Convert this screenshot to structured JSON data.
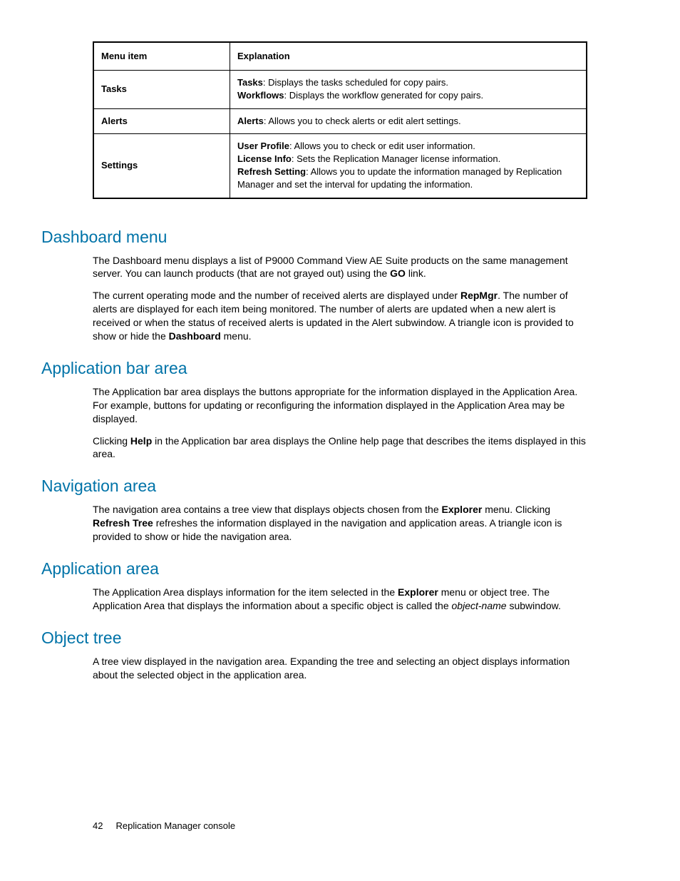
{
  "table": {
    "head": {
      "menu": "Menu item",
      "expl": "Explanation"
    },
    "rows": [
      {
        "menu": "Tasks",
        "lines": [
          {
            "b": "Tasks",
            "t": ": Displays the tasks scheduled for copy pairs."
          },
          {
            "b": "Workflows",
            "t": ": Displays the workflow generated for copy pairs."
          }
        ]
      },
      {
        "menu": "Alerts",
        "lines": [
          {
            "b": "Alerts",
            "t": ": Allows you to check alerts or edit alert settings."
          }
        ]
      },
      {
        "menu": "Settings",
        "lines": [
          {
            "b": "User Profile",
            "t": ": Allows you to check or edit user information."
          },
          {
            "b": "License Info",
            "t": ": Sets the Replication Manager license information."
          },
          {
            "b": "Refresh Setting",
            "t": ": Allows you to update the information managed by Replication Manager and set the interval for updating the information."
          }
        ]
      }
    ]
  },
  "sections": {
    "dashboard": {
      "title": "Dashboard menu",
      "p1a": "The Dashboard menu displays a list of P9000 Command View AE Suite products on the same management server.  You can launch products (that are not grayed out) using the ",
      "p1b": "GO",
      "p1c": " link.",
      "p2a": "The current operating mode and the number of received alerts are displayed under ",
      "p2b": "RepMgr",
      "p2c": ". The number of alerts are displayed for each item being monitored. The number of alerts are updated when a new alert is received or when the status of received alerts is updated in the Alert subwindow. A triangle icon is provided to show or hide the ",
      "p2d": "Dashboard",
      "p2e": " menu."
    },
    "appbar": {
      "title": "Application bar area",
      "p1": "The Application bar area displays the buttons appropriate for the information displayed in the Application Area. For example, buttons for updating or reconfiguring the information displayed in the Application Area may be displayed.",
      "p2a": "Clicking ",
      "p2b": "Help",
      "p2c": " in the Application bar area displays the Online help page that describes the items displayed in this area."
    },
    "nav": {
      "title": "Navigation area",
      "p1a": "The navigation area contains a tree view that displays objects chosen from the ",
      "p1b": "Explorer",
      "p1c": " menu. Clicking ",
      "p1d": "Refresh Tree",
      "p1e": " refreshes the information displayed in the navigation and application areas. A triangle icon is provided to show or hide the navigation area."
    },
    "apparea": {
      "title": "Application area",
      "p1a": "The Application Area displays information for the item selected in the ",
      "p1b": "Explorer",
      "p1c": " menu or object tree. The Application Area that displays the information about a specific object is called the ",
      "p1d": "object-name",
      "p1e": " subwindow."
    },
    "objtree": {
      "title": "Object tree",
      "p1": "A tree view displayed in the navigation area.  Expanding the tree and selecting an object displays information about the selected object in the application area."
    }
  },
  "footer": {
    "page": "42",
    "title": "Replication Manager console"
  }
}
